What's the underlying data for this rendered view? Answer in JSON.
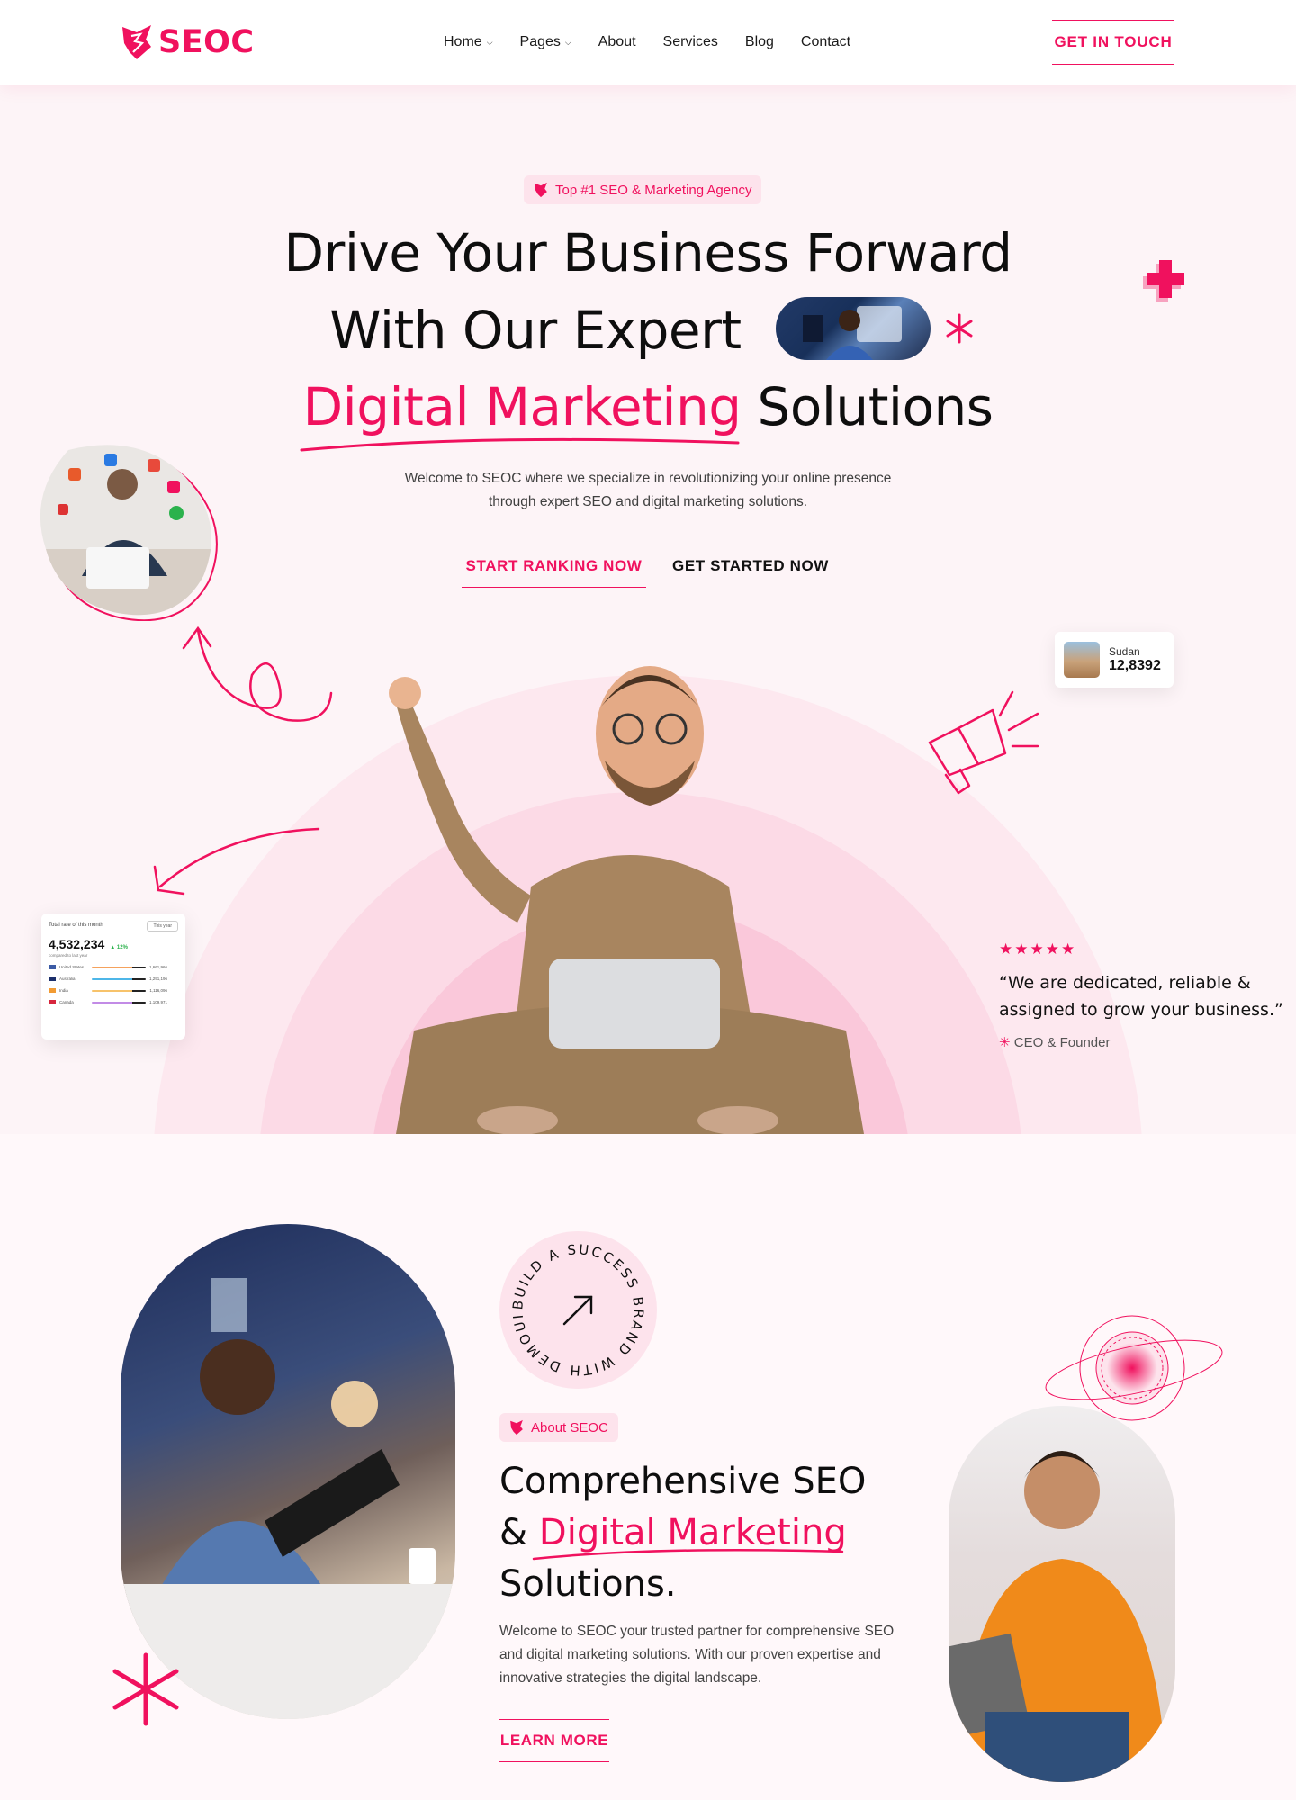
{
  "brand": {
    "name": "SEOC",
    "accent": "#f0115e"
  },
  "nav": {
    "items": [
      {
        "label": "Home",
        "dropdown": true
      },
      {
        "label": "Pages",
        "dropdown": true
      },
      {
        "label": "About",
        "dropdown": false
      },
      {
        "label": "Services",
        "dropdown": false
      },
      {
        "label": "Blog",
        "dropdown": false
      },
      {
        "label": "Contact",
        "dropdown": false
      }
    ],
    "cta": "GET IN TOUCH"
  },
  "hero": {
    "badge": "Top #1 SEO & Marketing Agency",
    "line1": "Drive Your Business Forward",
    "line2": "With Our Expert",
    "line3_accent": "Digital Marketing",
    "line3_rest": "Solutions",
    "subtitle": "Welcome to SEOC where we specialize in revolutionizing your online presence through expert SEO and digital marketing solutions.",
    "primary_button": "START RANKING NOW",
    "secondary_button": "GET STARTED NOW",
    "location_card": {
      "name": "Sudan",
      "value": "12,8392"
    },
    "stats_card": {
      "title": "Total rate of this month",
      "select": "This year",
      "total": "4,532,234",
      "change": "12%",
      "note": "compared to last year",
      "rows": [
        {
          "country": "United States",
          "value": "1,661,966",
          "color": "#f5a25d"
        },
        {
          "country": "Australia",
          "value": "1,291,196",
          "color": "#4db6e8"
        },
        {
          "country": "India",
          "value": "1,116,096",
          "color": "#f7c36b"
        },
        {
          "country": "Canada",
          "value": "1,109,971",
          "color": "#c28be6"
        }
      ]
    },
    "review": {
      "stars": "★★★★★",
      "quote": "“We are dedicated, reliable & assigned to grow your business.”",
      "author": "CEO & Founder"
    }
  },
  "about": {
    "circle_text": "BUILD A SUCCESS BRAND WITH DEMOUI",
    "badge": "About SEOC",
    "heading_part1": "Comprehensive SEO",
    "heading_amp": "& ",
    "heading_accent": "Digital Marketing",
    "heading_part3": "Solutions.",
    "paragraph": "Welcome to SEOC your trusted partner for comprehensive SEO and digital marketing solutions. With our proven expertise and innovative strategies the digital landscape.",
    "button": "LEARN MORE"
  }
}
